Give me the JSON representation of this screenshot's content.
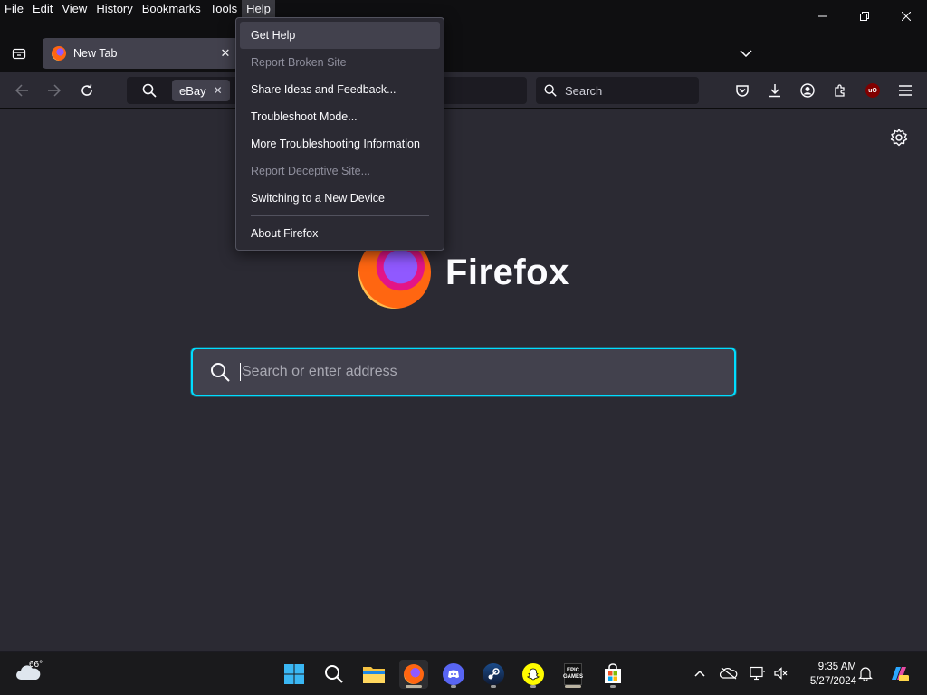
{
  "menubar": {
    "items": [
      "File",
      "Edit",
      "View",
      "History",
      "Bookmarks",
      "Tools",
      "Help"
    ],
    "active": "Help"
  },
  "tabs": [
    {
      "title": "New Tab"
    }
  ],
  "urlbar": {
    "engine_chip": "eBay",
    "placeholder": ""
  },
  "searchbar": {
    "placeholder": "Search"
  },
  "content": {
    "brand": "Firefox",
    "search_placeholder": "Search or enter address"
  },
  "help_menu": {
    "items": [
      {
        "label": "Get Help",
        "enabled": true,
        "highlighted": true
      },
      {
        "label": "Report Broken Site",
        "enabled": false
      },
      {
        "label": "Share Ideas and Feedback...",
        "enabled": true
      },
      {
        "label": "Troubleshoot Mode...",
        "enabled": true
      },
      {
        "label": "More Troubleshooting Information",
        "enabled": true
      },
      {
        "label": "Report Deceptive Site...",
        "enabled": false
      },
      {
        "label": "Switching to a New Device",
        "enabled": true
      },
      {
        "label": "About Firefox",
        "enabled": true
      }
    ]
  },
  "taskbar": {
    "weather_temp": "66°",
    "apps": [
      "windows-start",
      "search",
      "file-explorer",
      "firefox",
      "discord",
      "steam",
      "snapchat",
      "epic-games",
      "microsoft-store"
    ],
    "clock_time": "9:35 AM",
    "clock_date": "5/27/2024"
  },
  "colors": {
    "accent": "#00ddff",
    "toolbar_bg": "#2b2a33",
    "chrome_bg": "#0f0f11",
    "content_bg": "#2b2a33"
  }
}
